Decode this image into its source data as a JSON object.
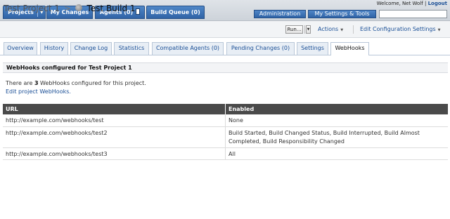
{
  "topnav": {
    "projects": "Projects",
    "my_changes": "My Changes",
    "agents": "Agents (0)",
    "build_queue": "Build Queue (0)"
  },
  "user": {
    "welcome": "Welcome, Net Wolf",
    "logout": "Logout",
    "administration": "Administration",
    "my_settings": "My Settings & Tools",
    "search_value": ""
  },
  "breadcrumb": {
    "project": "Test Project 1",
    "separator": ">",
    "build": "Test Build 1"
  },
  "toolbar": {
    "run": "Run",
    "run_dots": "...",
    "actions": "Actions",
    "edit_config": "Edit Configuration Settings"
  },
  "tabs": [
    {
      "label": "Overview"
    },
    {
      "label": "History"
    },
    {
      "label": "Change Log"
    },
    {
      "label": "Statistics"
    },
    {
      "label": "Compatible Agents (0)"
    },
    {
      "label": "Pending Changes (0)"
    },
    {
      "label": "Settings"
    },
    {
      "label": "WebHooks",
      "active": true
    }
  ],
  "section": {
    "title": "WebHooks configured for Test Project 1",
    "info_prefix": "There are ",
    "count": "3",
    "info_suffix": " WebHooks configured for this project.",
    "edit_link": "Edit project WebHooks."
  },
  "table": {
    "headers": [
      "URL",
      "Enabled"
    ],
    "rows": [
      {
        "url": "http://example.com/webhooks/test",
        "enabled": "None"
      },
      {
        "url": "http://example.com/webhooks/test2",
        "enabled": "Build Started, Build Changed Status, Build Interrupted, Build Almost Completed, Build Responsibility Changed"
      },
      {
        "url": "http://example.com/webhooks/test3",
        "enabled": "All"
      }
    ]
  },
  "colors": {
    "nav_blue": "#2f63a6",
    "link_blue": "#1a4f96",
    "table_header": "#4a4a4a"
  }
}
